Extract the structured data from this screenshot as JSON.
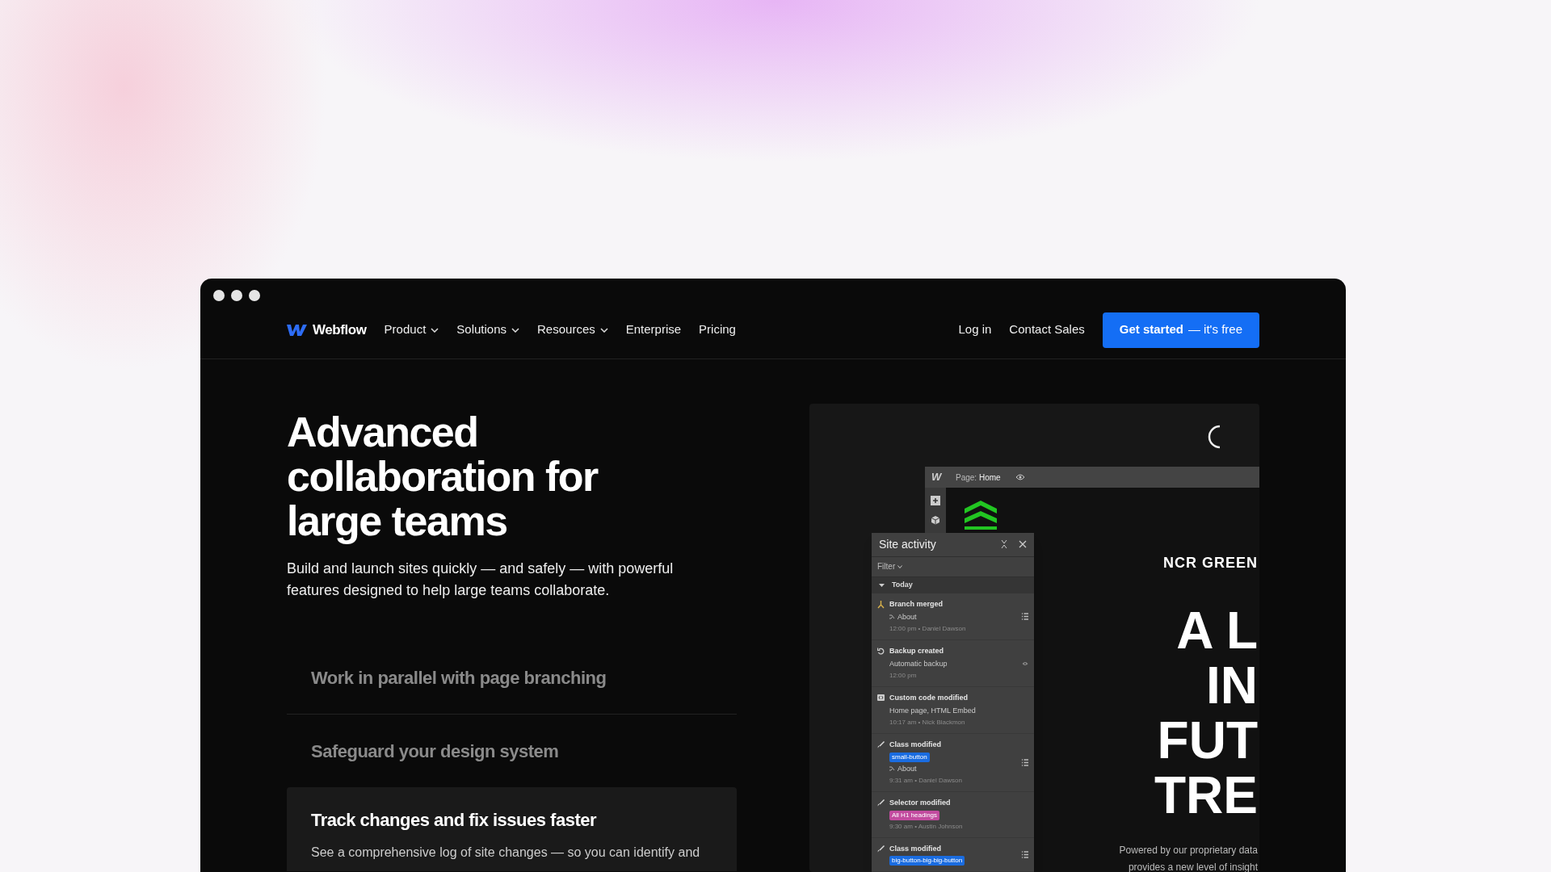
{
  "nav": {
    "brand": "Webflow",
    "links": [
      {
        "label": "Product",
        "dropdown": true
      },
      {
        "label": "Solutions",
        "dropdown": true
      },
      {
        "label": "Resources",
        "dropdown": true
      },
      {
        "label": "Enterprise",
        "dropdown": false
      },
      {
        "label": "Pricing",
        "dropdown": false
      }
    ],
    "login": "Log in",
    "contact": "Contact Sales",
    "cta": {
      "label": "Get started",
      "suffix": "— it's free"
    }
  },
  "hero": {
    "title_lines": [
      "Advanced",
      "collaboration for",
      "large teams"
    ],
    "subtitle": "Build and launch sites quickly — and safely — with powerful features designed to help large teams collaborate."
  },
  "features": [
    {
      "title": "Work in parallel with page branching",
      "selected": false
    },
    {
      "title": "Safeguard your design system",
      "selected": false
    },
    {
      "title": "Track changes and fix issues faster",
      "selected": true,
      "description": "See a comprehensive log of site changes — so you can identify and"
    }
  ],
  "preview": {
    "designer": {
      "logo": "W",
      "page_label": "Page:",
      "page_name": "Home"
    },
    "activity": {
      "title": "Site activity",
      "filter": "Filter",
      "group": "Today",
      "items": [
        {
          "kind": "merge",
          "title": "Branch merged",
          "page": "About",
          "meta": "12:00 pm • Daniel Dawson",
          "details": true,
          "preview": false
        },
        {
          "kind": "backup",
          "title": "Backup created",
          "detail": "Automatic backup",
          "meta": "12:00 pm",
          "details": false,
          "preview": true
        },
        {
          "kind": "code",
          "title": "Custom code modified",
          "detail": "Home page, HTML Embed",
          "meta": "10:17 am • Nick Blackmon",
          "details": false,
          "preview": false
        },
        {
          "kind": "brush",
          "title": "Class modified",
          "tag": {
            "label": "small-button",
            "color": "#1a6ce0"
          },
          "page": "About",
          "meta": "9:31 am • Daniel Dawson",
          "details": true,
          "preview": false
        },
        {
          "kind": "brush",
          "title": "Selector modified",
          "tag": {
            "label": "All H1 headings",
            "color": "#c24b9f"
          },
          "meta": "9:30 am • Austin Johnson",
          "details": false,
          "preview": false
        },
        {
          "kind": "brush",
          "title": "Class modified",
          "tag": {
            "label": "big-button-big-big-button",
            "color": "#1a6ce0"
          },
          "details": true,
          "preview": false
        }
      ]
    },
    "article": {
      "brand": "NCR GREEN",
      "headline": [
        "A L",
        "IN",
        "FUT",
        "TRE"
      ],
      "body": [
        "Powered by our proprietary data",
        "provides a new level of insight"
      ]
    }
  }
}
